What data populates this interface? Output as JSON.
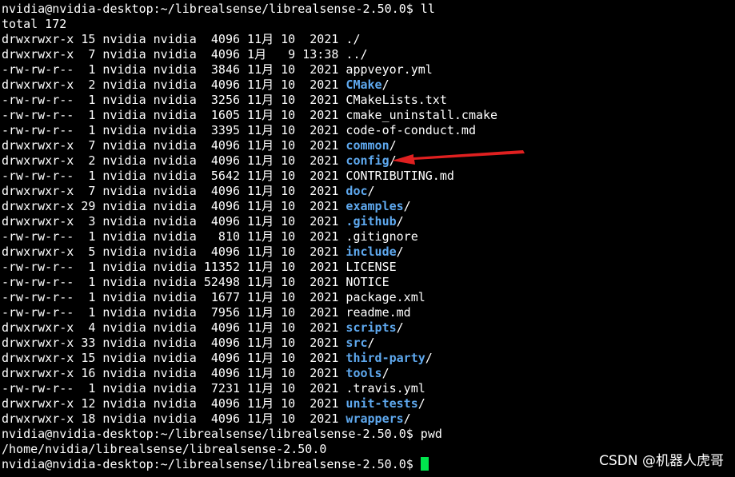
{
  "terminal": {
    "prompt": "nvidia@nvidia-desktop:~/librealsense/librealsense-2.50.0$ ",
    "cmd1": "ll",
    "total": "total 172",
    "entries": [
      {
        "meta": "drwxrwxr-x 15 nvidia nvidia  4096 11月 10  2021 ",
        "name": "./",
        "dir": false
      },
      {
        "meta": "drwxrwxr-x  7 nvidia nvidia  4096 1月   9 13:38 ",
        "name": "../",
        "dir": false
      },
      {
        "meta": "-rw-rw-r--  1 nvidia nvidia  3846 11月 10  2021 ",
        "name": "appveyor.yml",
        "dir": false
      },
      {
        "meta": "drwxrwxr-x  2 nvidia nvidia  4096 11月 10  2021 ",
        "name": "CMake",
        "dir": true
      },
      {
        "meta": "-rw-rw-r--  1 nvidia nvidia  3256 11月 10  2021 ",
        "name": "CMakeLists.txt",
        "dir": false
      },
      {
        "meta": "-rw-rw-r--  1 nvidia nvidia  1605 11月 10  2021 ",
        "name": "cmake_uninstall.cmake",
        "dir": false
      },
      {
        "meta": "-rw-rw-r--  1 nvidia nvidia  3395 11月 10  2021 ",
        "name": "code-of-conduct.md",
        "dir": false
      },
      {
        "meta": "drwxrwxr-x  7 nvidia nvidia  4096 11月 10  2021 ",
        "name": "common",
        "dir": true
      },
      {
        "meta": "drwxrwxr-x  2 nvidia nvidia  4096 11月 10  2021 ",
        "name": "config",
        "dir": true
      },
      {
        "meta": "-rw-rw-r--  1 nvidia nvidia  5642 11月 10  2021 ",
        "name": "CONTRIBUTING.md",
        "dir": false
      },
      {
        "meta": "drwxrwxr-x  7 nvidia nvidia  4096 11月 10  2021 ",
        "name": "doc",
        "dir": true
      },
      {
        "meta": "drwxrwxr-x 29 nvidia nvidia  4096 11月 10  2021 ",
        "name": "examples",
        "dir": true
      },
      {
        "meta": "drwxrwxr-x  3 nvidia nvidia  4096 11月 10  2021 ",
        "name": ".github",
        "dir": true
      },
      {
        "meta": "-rw-rw-r--  1 nvidia nvidia   810 11月 10  2021 ",
        "name": ".gitignore",
        "dir": false
      },
      {
        "meta": "drwxrwxr-x  5 nvidia nvidia  4096 11月 10  2021 ",
        "name": "include",
        "dir": true
      },
      {
        "meta": "-rw-rw-r--  1 nvidia nvidia 11352 11月 10  2021 ",
        "name": "LICENSE",
        "dir": false
      },
      {
        "meta": "-rw-rw-r--  1 nvidia nvidia 52498 11月 10  2021 ",
        "name": "NOTICE",
        "dir": false
      },
      {
        "meta": "-rw-rw-r--  1 nvidia nvidia  1677 11月 10  2021 ",
        "name": "package.xml",
        "dir": false
      },
      {
        "meta": "-rw-rw-r--  1 nvidia nvidia  7956 11月 10  2021 ",
        "name": "readme.md",
        "dir": false
      },
      {
        "meta": "drwxrwxr-x  4 nvidia nvidia  4096 11月 10  2021 ",
        "name": "scripts",
        "dir": true
      },
      {
        "meta": "drwxrwxr-x 33 nvidia nvidia  4096 11月 10  2021 ",
        "name": "src",
        "dir": true
      },
      {
        "meta": "drwxrwxr-x 15 nvidia nvidia  4096 11月 10  2021 ",
        "name": "third-party",
        "dir": true
      },
      {
        "meta": "drwxrwxr-x 16 nvidia nvidia  4096 11月 10  2021 ",
        "name": "tools",
        "dir": true
      },
      {
        "meta": "-rw-rw-r--  1 nvidia nvidia  7231 11月 10  2021 ",
        "name": ".travis.yml",
        "dir": false
      },
      {
        "meta": "drwxrwxr-x 12 nvidia nvidia  4096 11月 10  2021 ",
        "name": "unit-tests",
        "dir": true
      },
      {
        "meta": "drwxrwxr-x 18 nvidia nvidia  4096 11月 10  2021 ",
        "name": "wrappers",
        "dir": true
      }
    ],
    "cmd2": "pwd",
    "pwd_output": "/home/nvidia/librealsense/librealsense-2.50.0"
  },
  "watermark": "CSDN @机器人虎哥",
  "colors": {
    "background": "#000000",
    "text": "#ffffff",
    "directory": "#5ea8ee",
    "cursor": "#00e64d",
    "arrow": "#e02020"
  }
}
